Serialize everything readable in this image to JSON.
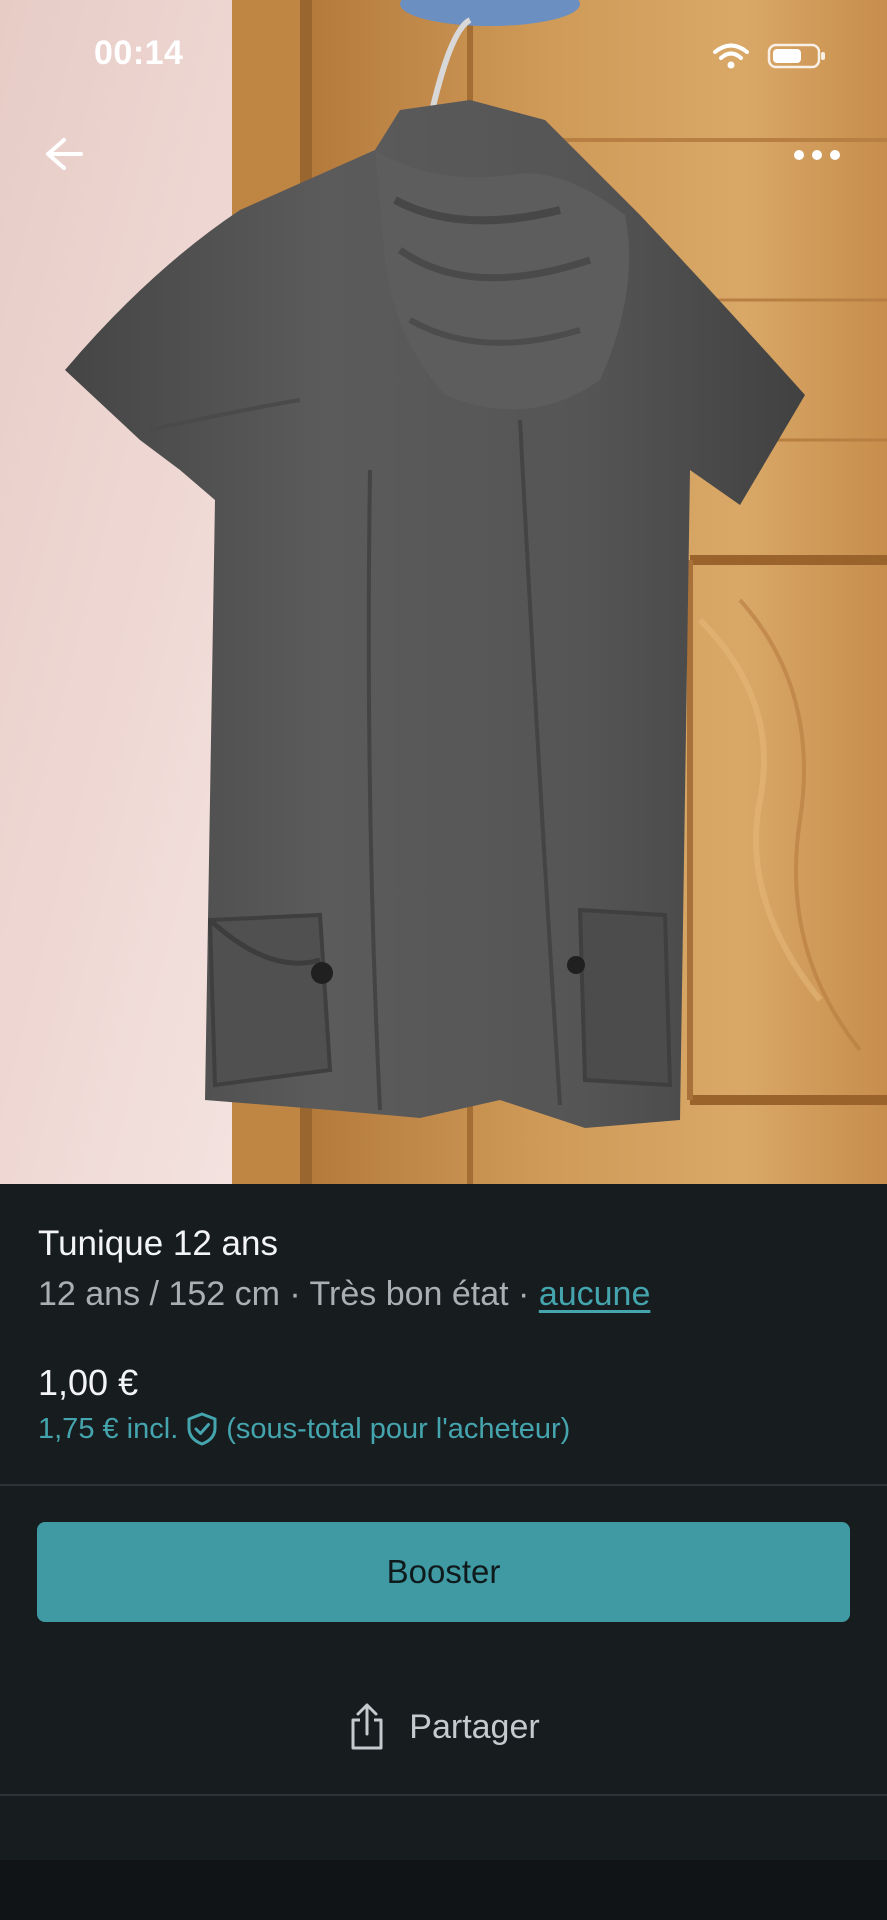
{
  "status_bar": {
    "time": "00:14",
    "icons": [
      "wifi-icon",
      "battery-icon"
    ]
  },
  "nav": {
    "back_icon": "arrow-left-icon",
    "more_icon": "more-dots-icon"
  },
  "photo": {
    "subject": "grey-tunic-photo"
  },
  "item": {
    "title": "Tunique 12 ans",
    "meta_prefix": "12 ans / 152 cm · Très bon état · ",
    "meta_link": "aucune",
    "price": "1,00 €",
    "price_incl": "1,75 € incl.",
    "price_incl_note": "(sous-total pour l'acheteur)"
  },
  "actions": {
    "booster_label": "Booster",
    "share_label": "Partager",
    "share_icon": "share-icon"
  },
  "colors": {
    "accent": "#3f9aa4",
    "link": "#45a5ae",
    "background": "#171c1f"
  }
}
